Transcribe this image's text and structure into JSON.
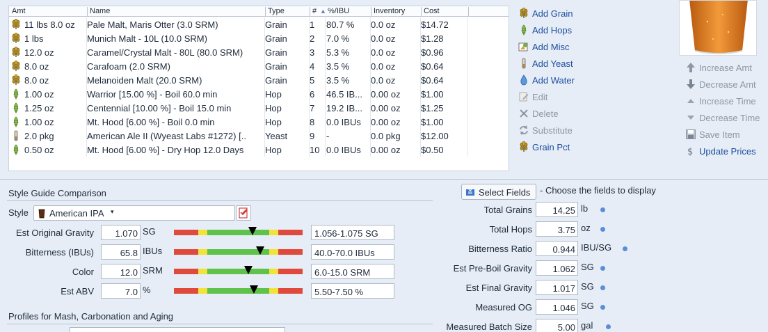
{
  "table": {
    "headers": {
      "amt": "Amt",
      "name": "Name",
      "type": "Type",
      "num": "#",
      "pct": "%/IBU",
      "inventory": "Inventory",
      "cost": "Cost"
    },
    "rows": [
      {
        "icon": "grain-icon",
        "amt": "11 lbs 8.0 oz",
        "name": "Pale Malt, Maris Otter (3.0 SRM)",
        "type": "Grain",
        "num": "1",
        "pct": "80.7 %",
        "inv": "0.0 oz",
        "cost": "$14.72"
      },
      {
        "icon": "grain-icon",
        "amt": "1 lbs",
        "name": "Munich Malt - 10L (10.0 SRM)",
        "type": "Grain",
        "num": "2",
        "pct": "7.0 %",
        "inv": "0.0 oz",
        "cost": "$1.28"
      },
      {
        "icon": "grain-icon",
        "amt": "12.0 oz",
        "name": "Caramel/Crystal Malt - 80L (80.0 SRM)",
        "type": "Grain",
        "num": "3",
        "pct": "5.3 %",
        "inv": "0.0 oz",
        "cost": "$0.96"
      },
      {
        "icon": "grain-icon",
        "amt": "8.0 oz",
        "name": "Carafoam (2.0 SRM)",
        "type": "Grain",
        "num": "4",
        "pct": "3.5 %",
        "inv": "0.0 oz",
        "cost": "$0.64"
      },
      {
        "icon": "grain-icon",
        "amt": "8.0 oz",
        "name": "Melanoiden Malt (20.0 SRM)",
        "type": "Grain",
        "num": "5",
        "pct": "3.5 %",
        "inv": "0.0 oz",
        "cost": "$0.64"
      },
      {
        "icon": "hop-icon",
        "amt": "1.00 oz",
        "name": "Warrior [15.00 %] - Boil 60.0 min",
        "type": "Hop",
        "num": "6",
        "pct": "46.5 IB...",
        "inv": "0.00 oz",
        "cost": "$1.00"
      },
      {
        "icon": "hop-icon",
        "amt": "1.25 oz",
        "name": "Centennial [10.00 %] - Boil 15.0 min",
        "type": "Hop",
        "num": "7",
        "pct": "19.2 IB...",
        "inv": "0.00 oz",
        "cost": "$1.25"
      },
      {
        "icon": "hop-icon",
        "amt": "1.00 oz",
        "name": "Mt. Hood [6.00 %] - Boil 0.0 min",
        "type": "Hop",
        "num": "8",
        "pct": "0.0 IBUs",
        "inv": "0.00 oz",
        "cost": "$1.00"
      },
      {
        "icon": "yeast-icon",
        "amt": "2.0 pkg",
        "name": "American Ale II (Wyeast Labs #1272) [..",
        "type": "Yeast",
        "num": "9",
        "pct": "-",
        "inv": "0.0 pkg",
        "cost": "$12.00"
      },
      {
        "icon": "hop-icon",
        "amt": "0.50 oz",
        "name": "Mt. Hood [6.00 %] - Dry Hop 12.0 Days",
        "type": "Hop",
        "num": "10",
        "pct": "0.0 IBUs",
        "inv": "0.00 oz",
        "cost": "$0.50"
      }
    ]
  },
  "actions_left": [
    {
      "label": "Add Grain",
      "icon": "grain-icon",
      "enabled": true
    },
    {
      "label": "Add Hops",
      "icon": "hop-icon",
      "enabled": true
    },
    {
      "label": "Add Misc",
      "icon": "misc-icon",
      "enabled": true
    },
    {
      "label": "Add Yeast",
      "icon": "yeast-icon",
      "enabled": true
    },
    {
      "label": "Add Water",
      "icon": "water-drop-icon",
      "enabled": true
    },
    {
      "label": "Edit",
      "icon": "edit-icon",
      "enabled": false
    },
    {
      "label": "Delete",
      "icon": "delete-x-icon",
      "enabled": false
    },
    {
      "label": "Substitute",
      "icon": "substitute-arrows-icon",
      "enabled": false
    },
    {
      "label": "Grain Pct",
      "icon": "grain-icon",
      "enabled": true
    }
  ],
  "actions_right": [
    {
      "label": "Increase Amt",
      "icon": "arrow-up-icon",
      "enabled": false
    },
    {
      "label": "Decrease Amt",
      "icon": "arrow-down-icon",
      "enabled": false
    },
    {
      "label": "Increase Time",
      "icon": "triangle-up-icon",
      "enabled": false
    },
    {
      "label": "Decrease Time",
      "icon": "triangle-down-icon",
      "enabled": false
    },
    {
      "label": "Save Item",
      "icon": "save-icon",
      "enabled": false
    },
    {
      "label": "Update Prices",
      "icon": "dollar-icon",
      "enabled": true
    }
  ],
  "style_guide": {
    "section_title": "Style Guide Comparison",
    "style_label": "Style",
    "style_value": "American IPA",
    "gauges": [
      {
        "label": "Est Original Gravity",
        "value": "1.070",
        "unit": "SG",
        "range": "1.056-1.075 SG",
        "marker_fraction": 0.61
      },
      {
        "label": "Bitterness (IBUs)",
        "value": "65.8",
        "unit": "IBUs",
        "range": "40.0-70.0 IBUs",
        "marker_fraction": 0.67
      },
      {
        "label": "Color",
        "value": "12.0",
        "unit": "SRM",
        "range": "6.0-15.0 SRM",
        "marker_fraction": 0.58
      },
      {
        "label": "Est ABV",
        "value": "7.0",
        "unit": "%",
        "range": "5.50-7.50 %",
        "marker_fraction": 0.62
      }
    ]
  },
  "profiles": {
    "section_title": "Profiles for Mash, Carbonation and Aging"
  },
  "fields": {
    "select_button": "Select Fields",
    "choose_text": "- Choose the fields to display",
    "items": [
      {
        "label": "Total Grains",
        "value": "14.25",
        "unit": "lb"
      },
      {
        "label": "Total Hops",
        "value": "3.75",
        "unit": "oz"
      },
      {
        "label": "Bitterness Ratio",
        "value": "0.944",
        "unit": "IBU/SG"
      },
      {
        "label": "Est Pre-Boil Gravity",
        "value": "1.062",
        "unit": "SG"
      },
      {
        "label": "Est Final Gravity",
        "value": "1.017",
        "unit": "SG"
      },
      {
        "label": "Measured OG",
        "value": "1.046",
        "unit": "SG"
      },
      {
        "label": "Measured Batch Size",
        "value": "5.00",
        "unit": "gal"
      }
    ]
  },
  "colors": {
    "link": "#1d4fa0",
    "disabled": "#8c96a4",
    "beer": "#e0751c",
    "gauge_red": "#e04a3c",
    "gauge_yellow": "#f2e33a",
    "gauge_green": "#5fc24a"
  }
}
